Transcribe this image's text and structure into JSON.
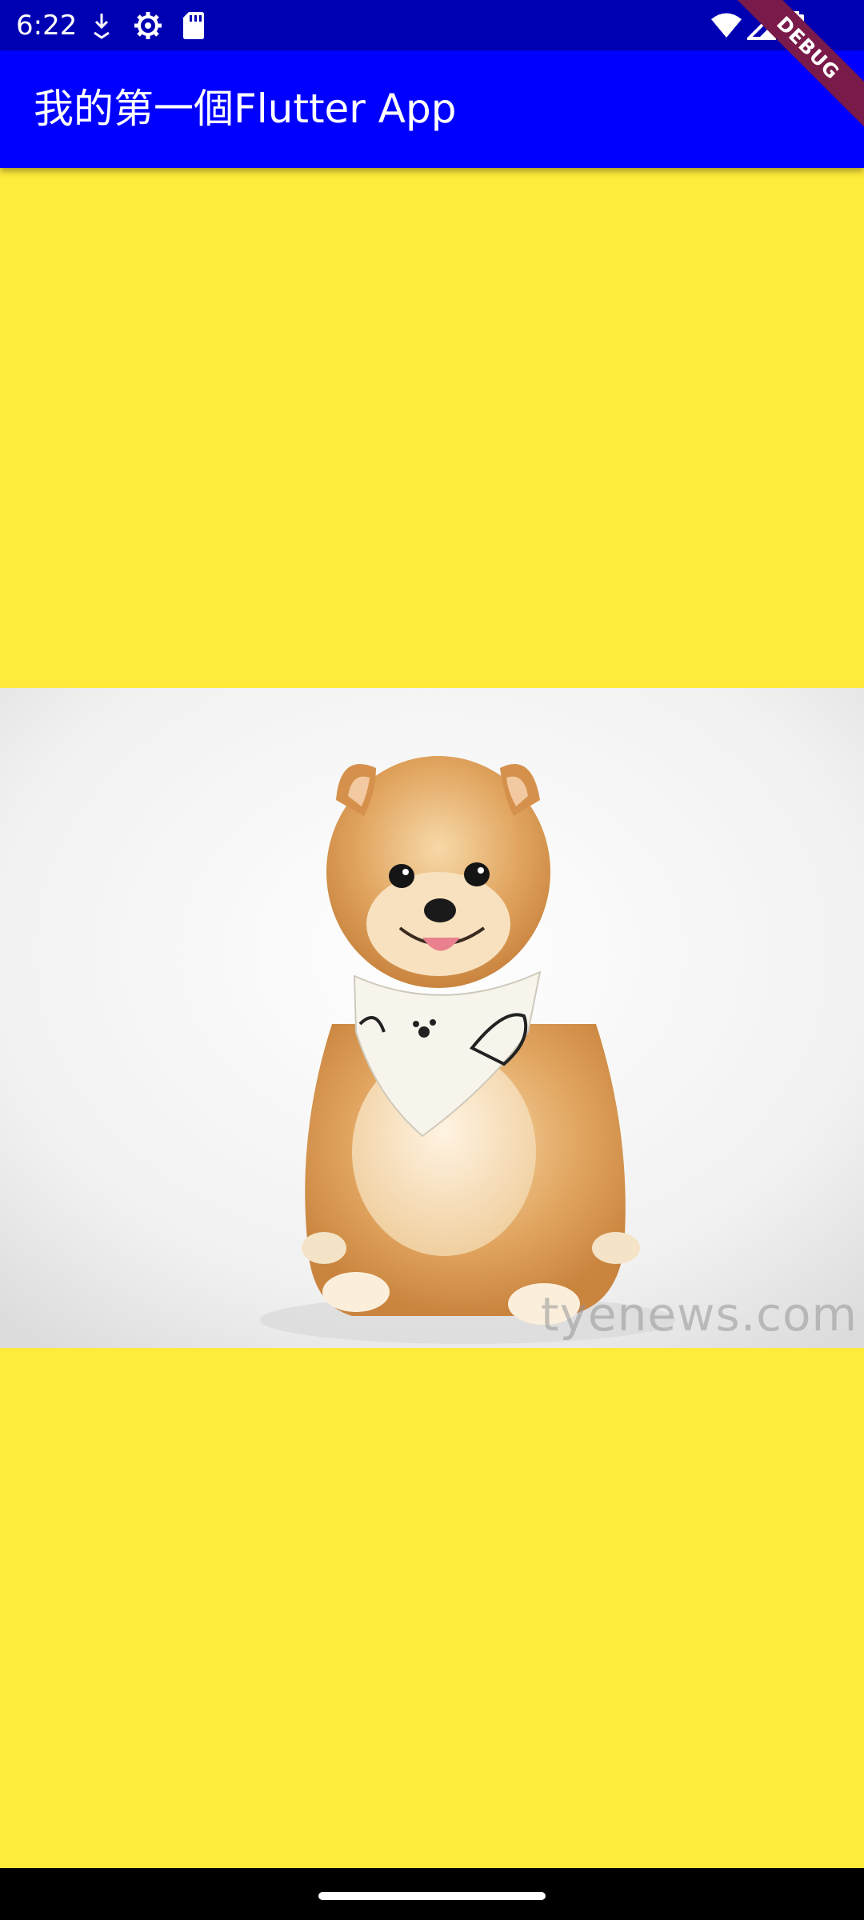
{
  "status_bar": {
    "time": "6:22",
    "left_icons": [
      "download-icon",
      "settings-icon",
      "sd-card-icon"
    ],
    "right_icons": [
      "wifi-icon",
      "cell-signal-icon",
      "battery-icon"
    ]
  },
  "app_bar": {
    "title": "我的第一個Flutter App"
  },
  "debug_banner": {
    "label": "DEBUG"
  },
  "image": {
    "subject": "pomeranian-dog-photo",
    "watermark": "tyenews.com"
  },
  "colors": {
    "status_bar": "#0000b3",
    "app_bar": "#0000ff",
    "body_background": "#ffeb3b",
    "debug_banner": "#7a1a4a"
  }
}
